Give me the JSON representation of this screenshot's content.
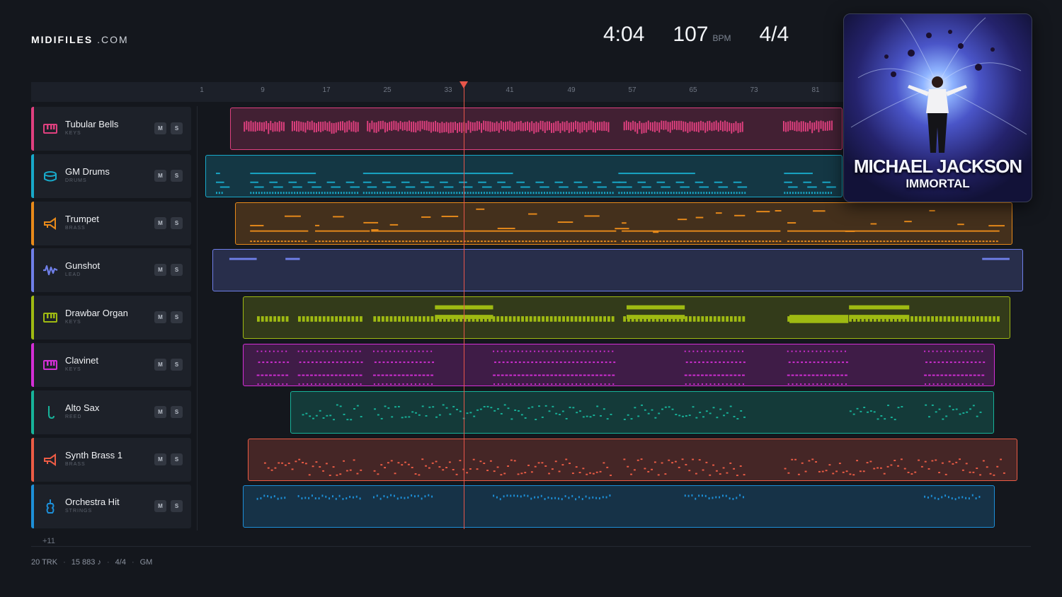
{
  "brand": {
    "name": "MIDIFILES",
    "suffix": ".COM"
  },
  "transport": {
    "time": "4:04",
    "tempo": "107",
    "tempo_unit": "BPM",
    "meter": "4/4"
  },
  "ruler": {
    "bars": [
      "1",
      "9",
      "17",
      "25",
      "33",
      "41",
      "49",
      "57",
      "65",
      "73",
      "81"
    ]
  },
  "playhead_bar": 34,
  "tracks": [
    {
      "name": "Tubular Bells",
      "category": "KEYS",
      "icon": "piano-keys-icon",
      "color": "#e0407f",
      "mute": "M",
      "solo": "S"
    },
    {
      "name": "GM Drums",
      "category": "DRUMS",
      "icon": "drum-icon",
      "color": "#18a9c9",
      "mute": "M",
      "solo": "S"
    },
    {
      "name": "Trumpet",
      "category": "BRASS",
      "icon": "trumpet-icon",
      "color": "#e88a1a",
      "mute": "M",
      "solo": "S"
    },
    {
      "name": "Gunshot",
      "category": "LEAD",
      "icon": "waveform-icon",
      "color": "#6f7fe8",
      "mute": "M",
      "solo": "S"
    },
    {
      "name": "Drawbar Organ",
      "category": "KEYS",
      "icon": "piano-keys-icon",
      "color": "#9fba12",
      "mute": "M",
      "solo": "S"
    },
    {
      "name": "Clavinet",
      "category": "KEYS",
      "icon": "piano-keys-icon",
      "color": "#d42fd6",
      "mute": "M",
      "solo": "S"
    },
    {
      "name": "Alto Sax",
      "category": "REED",
      "icon": "saxophone-icon",
      "color": "#17b39a",
      "mute": "M",
      "solo": "S"
    },
    {
      "name": "Synth Brass 1",
      "category": "BRASS",
      "icon": "trumpet-icon",
      "color": "#ec5c45",
      "mute": "M",
      "solo": "S"
    },
    {
      "name": "Orchestra Hit",
      "category": "STRINGS",
      "icon": "violin-icon",
      "color": "#1d8fd8",
      "mute": "M",
      "solo": "S"
    }
  ],
  "more_tracks": "+11",
  "footer": {
    "tracks": "20 TRK",
    "notes": "15 883 ♪",
    "meter": "4/4",
    "standard": "GM"
  },
  "album": {
    "artist": "MICHAEL JACKSON",
    "title": "IMMORTAL"
  }
}
